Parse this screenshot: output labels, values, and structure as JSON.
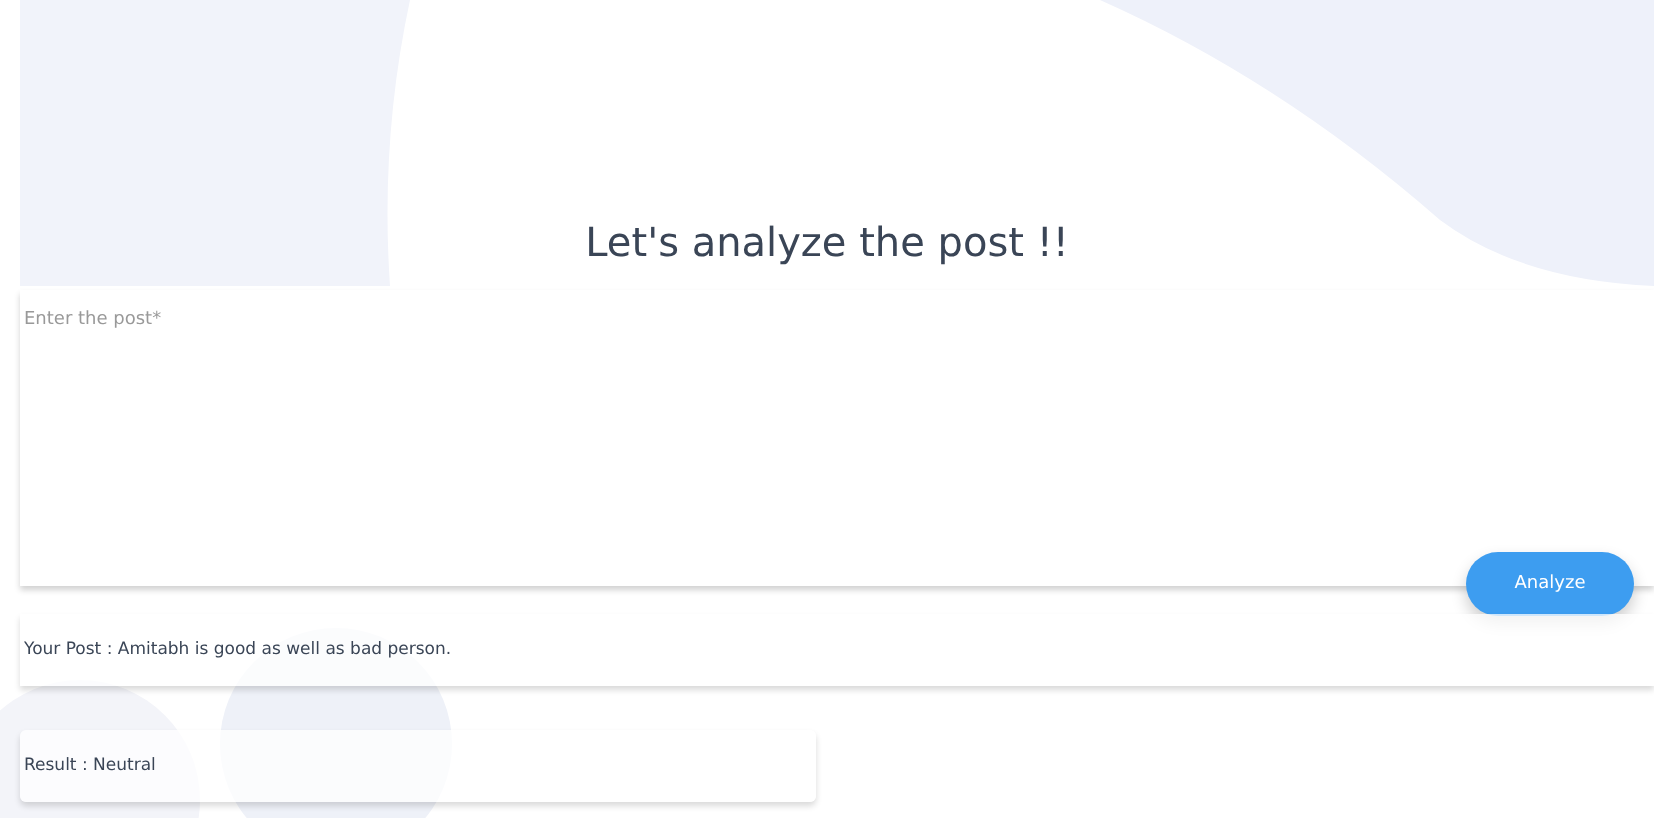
{
  "heading": "Let's analyze the post !!",
  "post_field": {
    "placeholder": "Enter the post*"
  },
  "analyze_button": "Analyze",
  "post_echo": "Your Post : Amitabh is good as well as bad person.",
  "result": "Result : Neutral"
}
